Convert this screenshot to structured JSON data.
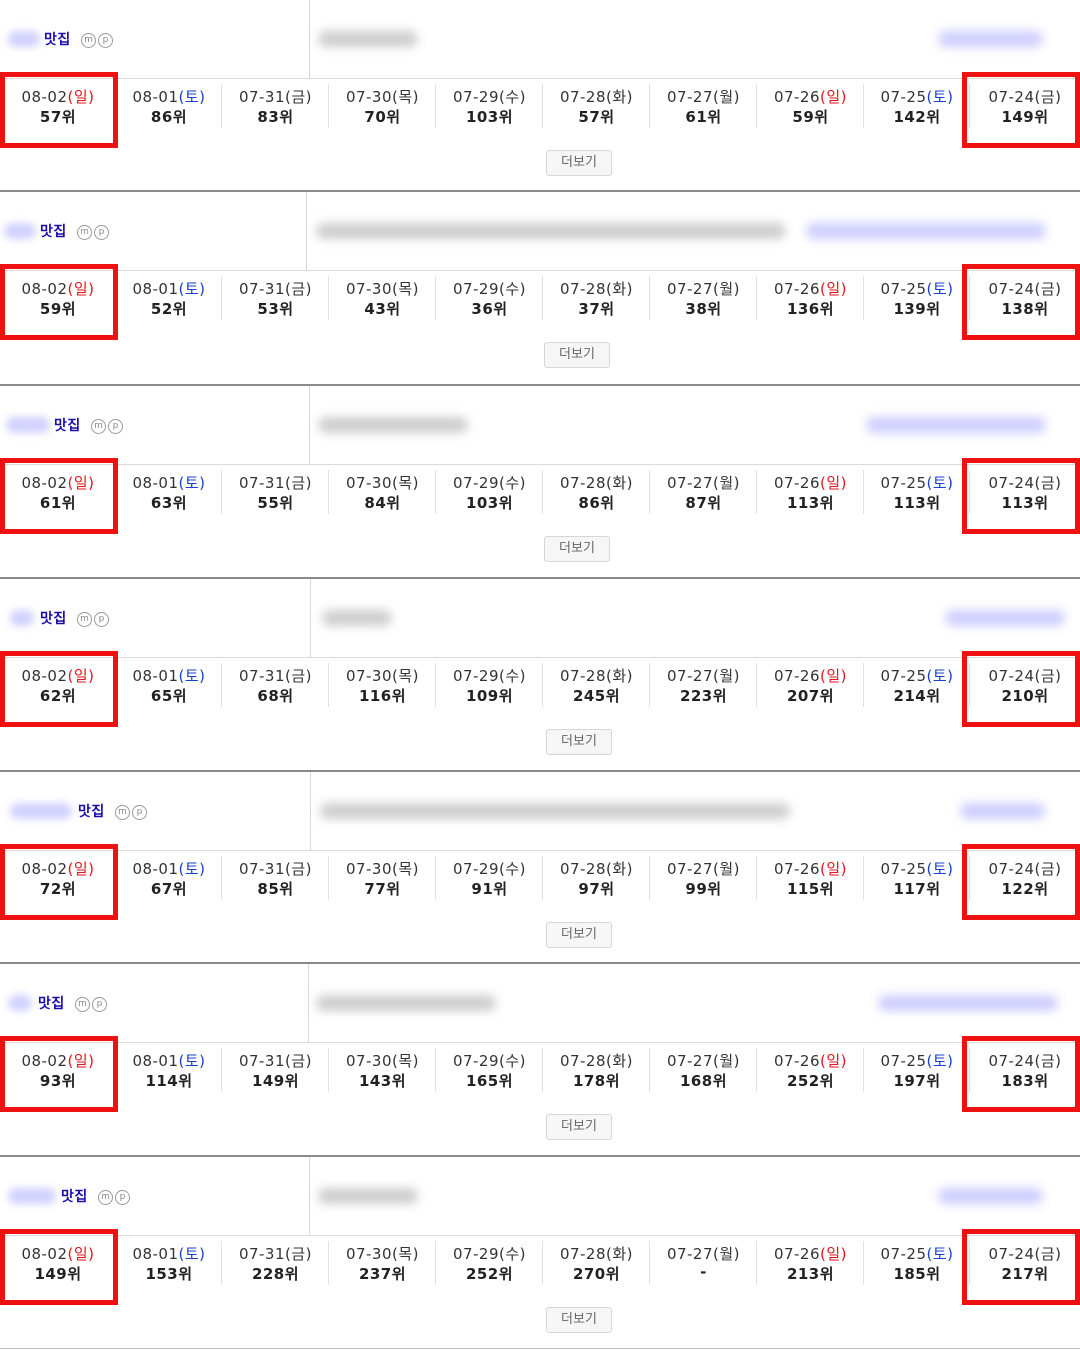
{
  "colors": {
    "highlight": "#ef1010",
    "sunday": "#e5161b",
    "saturday": "#1a3fd4"
  },
  "icons": [
    "mobile-icon",
    "pc-icon"
  ],
  "icon_glyphs": {
    "mobile": "m",
    "pc": "p"
  },
  "panels": [
    {
      "keyword": "맛집",
      "more_label": "더보기",
      "dates": [
        {
          "md": "08-02",
          "day": "(일)",
          "rank": "57위"
        },
        {
          "md": "08-01",
          "day": "(토)",
          "rank": "86위"
        },
        {
          "md": "07-31",
          "day": "(금)",
          "rank": "83위"
        },
        {
          "md": "07-30",
          "day": "(목)",
          "rank": "70위"
        },
        {
          "md": "07-29",
          "day": "(수)",
          "rank": "103위"
        },
        {
          "md": "07-28",
          "day": "(화)",
          "rank": "57위"
        },
        {
          "md": "07-27",
          "day": "(월)",
          "rank": "61위"
        },
        {
          "md": "07-26",
          "day": "(일)",
          "rank": "59위"
        },
        {
          "md": "07-25",
          "day": "(토)",
          "rank": "142위"
        },
        {
          "md": "07-24",
          "day": "(금)",
          "rank": "149위"
        }
      ]
    },
    {
      "keyword": "맛집",
      "more_label": "더보기",
      "dates": [
        {
          "md": "08-02",
          "day": "(일)",
          "rank": "59위"
        },
        {
          "md": "08-01",
          "day": "(토)",
          "rank": "52위"
        },
        {
          "md": "07-31",
          "day": "(금)",
          "rank": "53위"
        },
        {
          "md": "07-30",
          "day": "(목)",
          "rank": "43위"
        },
        {
          "md": "07-29",
          "day": "(수)",
          "rank": "36위"
        },
        {
          "md": "07-28",
          "day": "(화)",
          "rank": "37위"
        },
        {
          "md": "07-27",
          "day": "(월)",
          "rank": "38위"
        },
        {
          "md": "07-26",
          "day": "(일)",
          "rank": "136위"
        },
        {
          "md": "07-25",
          "day": "(토)",
          "rank": "139위"
        },
        {
          "md": "07-24",
          "day": "(금)",
          "rank": "138위"
        }
      ]
    },
    {
      "keyword": "맛집",
      "more_label": "더보기",
      "dates": [
        {
          "md": "08-02",
          "day": "(일)",
          "rank": "61위"
        },
        {
          "md": "08-01",
          "day": "(토)",
          "rank": "63위"
        },
        {
          "md": "07-31",
          "day": "(금)",
          "rank": "55위"
        },
        {
          "md": "07-30",
          "day": "(목)",
          "rank": "84위"
        },
        {
          "md": "07-29",
          "day": "(수)",
          "rank": "103위"
        },
        {
          "md": "07-28",
          "day": "(화)",
          "rank": "86위"
        },
        {
          "md": "07-27",
          "day": "(월)",
          "rank": "87위"
        },
        {
          "md": "07-26",
          "day": "(일)",
          "rank": "113위"
        },
        {
          "md": "07-25",
          "day": "(토)",
          "rank": "113위"
        },
        {
          "md": "07-24",
          "day": "(금)",
          "rank": "113위"
        }
      ]
    },
    {
      "keyword": "맛집",
      "more_label": "더보기",
      "dates": [
        {
          "md": "08-02",
          "day": "(일)",
          "rank": "62위"
        },
        {
          "md": "08-01",
          "day": "(토)",
          "rank": "65위"
        },
        {
          "md": "07-31",
          "day": "(금)",
          "rank": "68위"
        },
        {
          "md": "07-30",
          "day": "(목)",
          "rank": "116위"
        },
        {
          "md": "07-29",
          "day": "(수)",
          "rank": "109위"
        },
        {
          "md": "07-28",
          "day": "(화)",
          "rank": "245위"
        },
        {
          "md": "07-27",
          "day": "(월)",
          "rank": "223위"
        },
        {
          "md": "07-26",
          "day": "(일)",
          "rank": "207위"
        },
        {
          "md": "07-25",
          "day": "(토)",
          "rank": "214위"
        },
        {
          "md": "07-24",
          "day": "(금)",
          "rank": "210위"
        }
      ]
    },
    {
      "keyword": "맛집",
      "more_label": "더보기",
      "dates": [
        {
          "md": "08-02",
          "day": "(일)",
          "rank": "72위"
        },
        {
          "md": "08-01",
          "day": "(토)",
          "rank": "67위"
        },
        {
          "md": "07-31",
          "day": "(금)",
          "rank": "85위"
        },
        {
          "md": "07-30",
          "day": "(목)",
          "rank": "77위"
        },
        {
          "md": "07-29",
          "day": "(수)",
          "rank": "91위"
        },
        {
          "md": "07-28",
          "day": "(화)",
          "rank": "97위"
        },
        {
          "md": "07-27",
          "day": "(월)",
          "rank": "99위"
        },
        {
          "md": "07-26",
          "day": "(일)",
          "rank": "115위"
        },
        {
          "md": "07-25",
          "day": "(토)",
          "rank": "117위"
        },
        {
          "md": "07-24",
          "day": "(금)",
          "rank": "122위"
        }
      ]
    },
    {
      "keyword": "맛집",
      "more_label": "더보기",
      "dates": [
        {
          "md": "08-02",
          "day": "(일)",
          "rank": "93위"
        },
        {
          "md": "08-01",
          "day": "(토)",
          "rank": "114위"
        },
        {
          "md": "07-31",
          "day": "(금)",
          "rank": "149위"
        },
        {
          "md": "07-30",
          "day": "(목)",
          "rank": "143위"
        },
        {
          "md": "07-29",
          "day": "(수)",
          "rank": "165위"
        },
        {
          "md": "07-28",
          "day": "(화)",
          "rank": "178위"
        },
        {
          "md": "07-27",
          "day": "(월)",
          "rank": "168위"
        },
        {
          "md": "07-26",
          "day": "(일)",
          "rank": "252위"
        },
        {
          "md": "07-25",
          "day": "(토)",
          "rank": "197위"
        },
        {
          "md": "07-24",
          "day": "(금)",
          "rank": "183위"
        }
      ]
    },
    {
      "keyword": "맛집",
      "more_label": "더보기",
      "dates": [
        {
          "md": "08-02",
          "day": "(일)",
          "rank": "149위"
        },
        {
          "md": "08-01",
          "day": "(토)",
          "rank": "153위"
        },
        {
          "md": "07-31",
          "day": "(금)",
          "rank": "228위"
        },
        {
          "md": "07-30",
          "day": "(목)",
          "rank": "237위"
        },
        {
          "md": "07-29",
          "day": "(수)",
          "rank": "252위"
        },
        {
          "md": "07-28",
          "day": "(화)",
          "rank": "270위"
        },
        {
          "md": "07-27",
          "day": "(월)",
          "rank": "-"
        },
        {
          "md": "07-26",
          "day": "(일)",
          "rank": "213위"
        },
        {
          "md": "07-25",
          "day": "(토)",
          "rank": "185위"
        },
        {
          "md": "07-24",
          "day": "(금)",
          "rank": "217위"
        }
      ]
    }
  ]
}
